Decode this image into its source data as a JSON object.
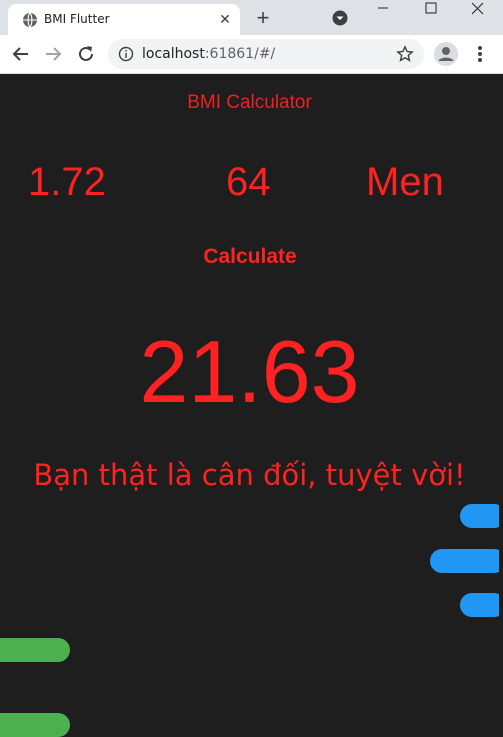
{
  "browser": {
    "tab_title": "BMI Flutter",
    "url_host": "localhost",
    "url_rest": ":61861/#/",
    "icons": {
      "favicon": "globe-icon",
      "tab_close": "close-icon",
      "new_tab": "plus-icon",
      "tab_search": "tab-search-icon",
      "back": "arrow-left-icon",
      "forward": "arrow-right-icon",
      "reload": "reload-icon",
      "site_info": "info-icon",
      "bookmark": "star-icon",
      "profile": "profile-icon",
      "menu": "kebab-menu-icon"
    }
  },
  "app": {
    "title": "BMI Calculator",
    "height_value": "1.72",
    "weight_value": "64",
    "gender_value": "Men",
    "calculate_label": "Calculate",
    "bmi_result": "21.63",
    "bmi_message": "Bạn thật là cân đối, tuyệt vời!",
    "colors": {
      "background": "#1e1e1e",
      "text": "#ff2222",
      "accent_blue": "#2196f3",
      "accent_green": "#4caf50"
    }
  }
}
